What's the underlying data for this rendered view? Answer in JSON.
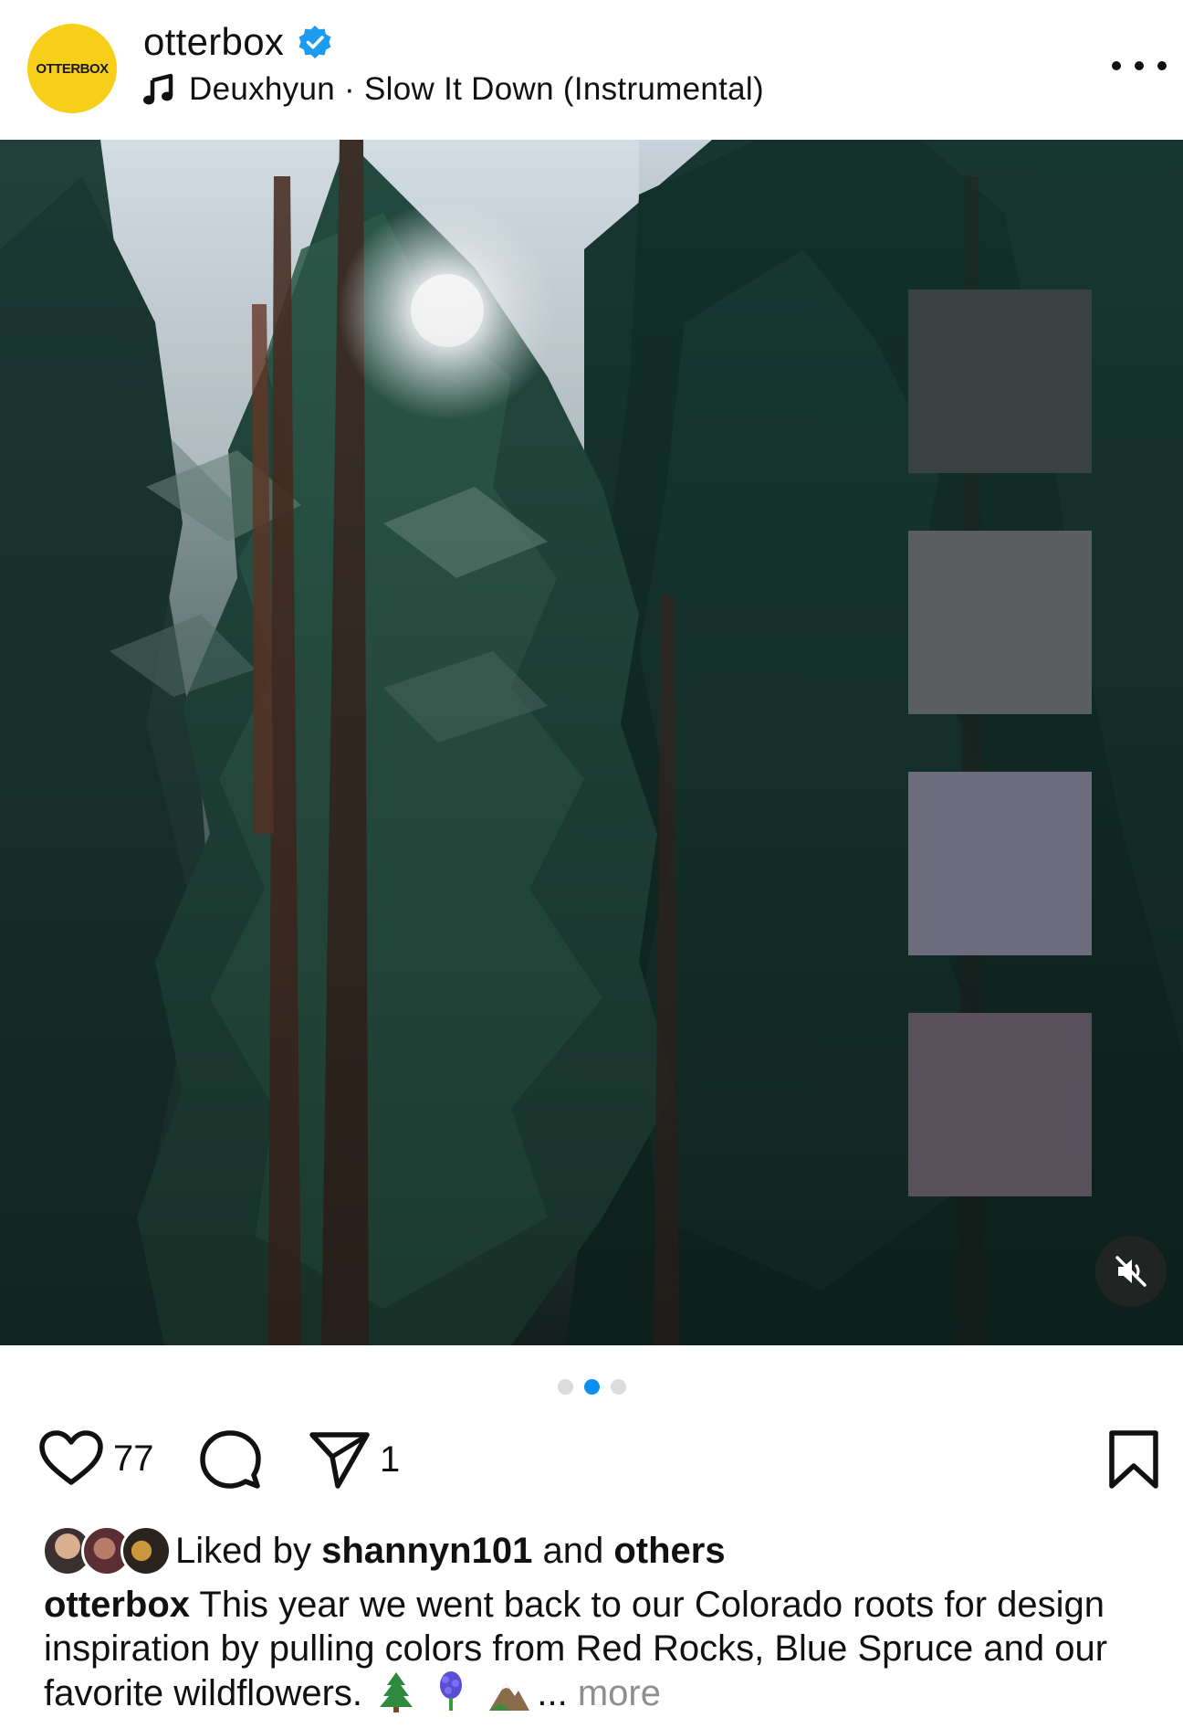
{
  "post": {
    "username": "otterbox",
    "avatar_text": "OTTERBOX",
    "verified_icon": "verified-badge-icon",
    "music": "Deuxhyun · Slow It Down (Instrumental)",
    "more_icon": "more-options-icon"
  },
  "palette": {
    "swatches": [
      "#3a4241",
      "#5b5e5e",
      "#6c6c7c",
      "#58515c"
    ]
  },
  "carousel": {
    "total": 3,
    "active_index": 1
  },
  "actions": {
    "likes_count": "77",
    "shares_count": "1",
    "icons": [
      "heart-icon",
      "comment-icon",
      "share-icon",
      "bookmark-icon"
    ]
  },
  "likes": {
    "prefix": "Liked by",
    "user": "shannyn101",
    "and": "and",
    "others": "others"
  },
  "caption": {
    "user": "otterbox",
    "text": "This year we went back to our Colorado roots for design inspiration by pulling colors from Red Rocks, Blue Spruce and our favorite wildflowers.",
    "ellipsis": "...",
    "more": "more"
  },
  "colors": {
    "verified": "#1d9bf0",
    "carousel_active": "#0d8ff2",
    "more_text": "#8e8e8e",
    "avatar_bg": "#f7cf1b"
  }
}
